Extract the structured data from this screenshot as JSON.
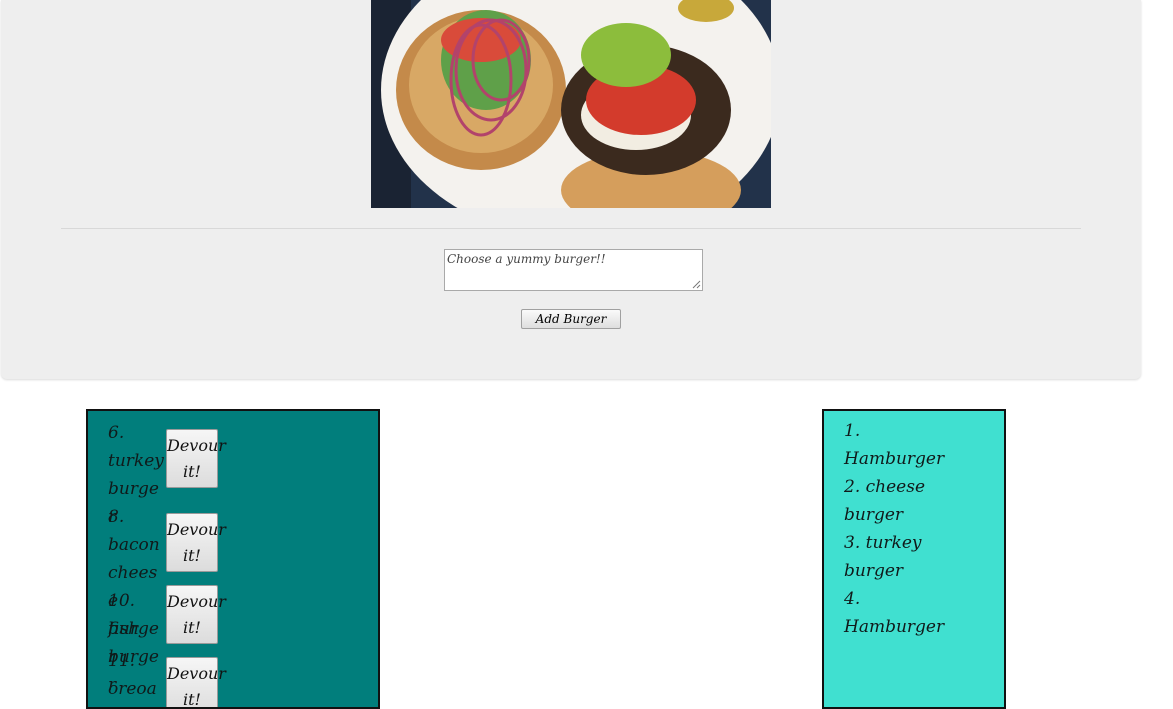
{
  "form": {
    "placeholder": "Choose a yummy burger!!",
    "submit_label": "Add Burger"
  },
  "devour_label_line1": "Devour",
  "devour_label_line2": "it!",
  "uneaten": [
    {
      "text": "6. turkey burger"
    },
    {
      "text": "8. bacon cheese burger"
    },
    {
      "text": "10. fish burger"
    },
    {
      "text": "11. oreoao"
    }
  ],
  "devoured": [
    {
      "text": "1. Hamburger"
    },
    {
      "text": "2. cheese burger"
    },
    {
      "text": "3. turkey burger"
    },
    {
      "text": "4. Hamburger"
    }
  ],
  "colors": {
    "jumbotron_bg": "#eeeeee",
    "uneaten_panel_bg": "#017e7c",
    "devoured_panel_bg": "#40e0d0"
  }
}
